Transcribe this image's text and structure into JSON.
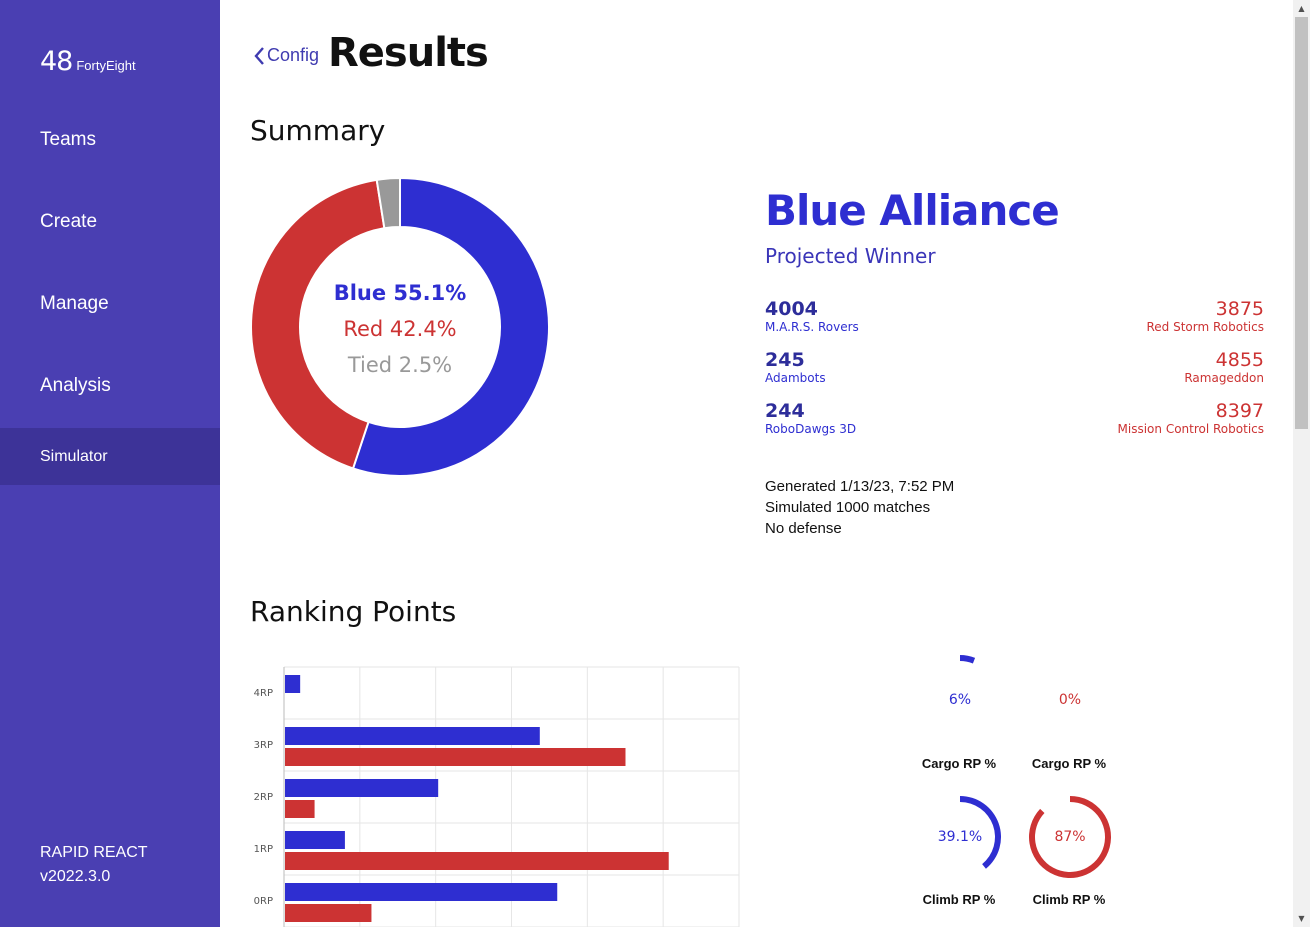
{
  "brand": {
    "number": "48",
    "name": "FortyEight"
  },
  "nav": [
    "Teams",
    "Create",
    "Manage",
    "Analysis",
    "Simulator"
  ],
  "active_nav": "Simulator",
  "footer": {
    "game": "RAPID REACT",
    "version": "v2022.3.0"
  },
  "header": {
    "back_label": "Config",
    "title": "Results"
  },
  "summary": {
    "section_title": "Summary",
    "blue_label": "Blue 55.1%",
    "red_label": "Red 42.4%",
    "tied_label": "Tied 2.5%",
    "blue_pct": 55.1,
    "red_pct": 42.4,
    "tied_pct": 2.5,
    "winner": "Blue Alliance",
    "winner_sub": "Projected Winner",
    "blue_teams": [
      {
        "number": "4004",
        "name": "M.A.R.S. Rovers"
      },
      {
        "number": "245",
        "name": "Adambots"
      },
      {
        "number": "244",
        "name": "RoboDawgs 3D"
      }
    ],
    "red_teams": [
      {
        "number": "3875",
        "name": "Red Storm Robotics"
      },
      {
        "number": "4855",
        "name": "Ramageddon"
      },
      {
        "number": "8397",
        "name": "Mission Control Robotics"
      }
    ],
    "generated": "Generated 1/13/23, 7:52 PM",
    "simulated": "Simulated 1000 matches",
    "defense": "No defense"
  },
  "ranking": {
    "section_title": "Ranking Points",
    "gauges": [
      {
        "value_label": "6%",
        "value": 6,
        "label": "Cargo RP %",
        "color": "#2e2ed1"
      },
      {
        "value_label": "0%",
        "value": 0,
        "label": "Cargo RP %",
        "color": "#cc3333"
      },
      {
        "value_label": "39.1%",
        "value": 39.1,
        "label": "Climb RP %",
        "color": "#2e2ed1"
      },
      {
        "value_label": "87%",
        "value": 87,
        "label": "Climb RP %",
        "color": "#cc3333"
      }
    ]
  },
  "chart_data": {
    "type": "bar",
    "orientation": "horizontal",
    "categories": [
      "4RP",
      "3RP",
      "2RP",
      "1RP",
      "0RP"
    ],
    "series": [
      {
        "values": [
          2,
          33.6,
          20.2,
          7.9,
          35.9
        ],
        "color": "#2e2ed1"
      },
      {
        "values": [
          0,
          44.9,
          3.9,
          50.6,
          11.4
        ],
        "color": "#cc3333"
      }
    ],
    "xlim": [
      0,
      60
    ],
    "grid": true
  }
}
